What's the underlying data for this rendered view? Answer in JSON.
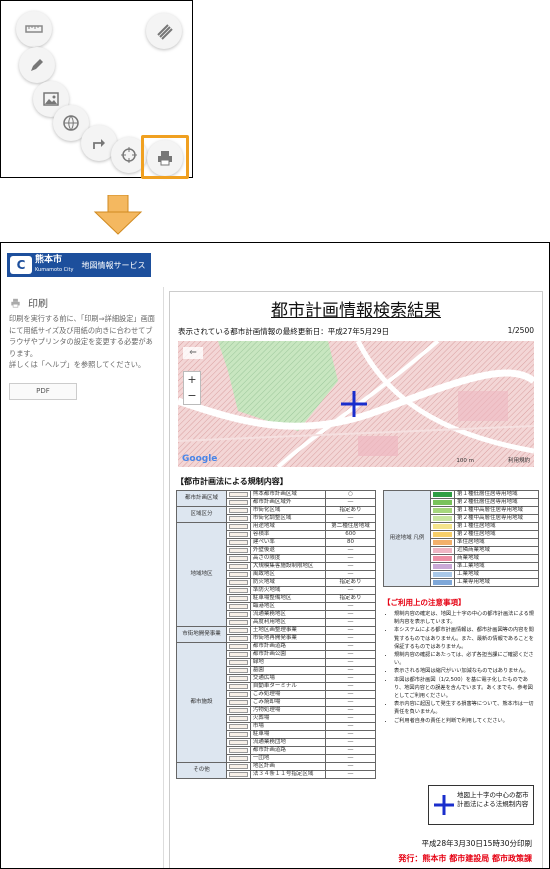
{
  "topbox": {
    "tools": [
      "ruler-icon",
      "menu-icon",
      "pen-icon",
      "image-icon",
      "globe-icon",
      "route-arrow-icon",
      "crosshair-icon",
      "print-icon"
    ]
  },
  "header": {
    "logo_city": "熊本市",
    "logo_sub": "Kumamoto City",
    "logo_service": "地図情報サービス"
  },
  "sidebar": {
    "title": "印刷",
    "desc": "印刷を実行する前に、「印刷⇒詳細設定」画面にて用紙サイズ及び用紙の向きに合わせてブラウザやプリンタの設定を変更する必要があります。\n詳しくは「ヘルプ」を参照してください。",
    "pdf_button": "PDF"
  },
  "paper": {
    "title": "都市計画情報検索結果",
    "updated": "表示されている都市計画情報の最終更新日：平成27年5月29日",
    "scale": "1/2500",
    "map_scale": "100 m",
    "map_terms": "利用規約",
    "map_brand": "Google",
    "section_title": "【都市計画法による規制内容】",
    "notice_title": "【ご利用上の注意事項】",
    "notice_items": [
      "規制内容の確定は、地図上十字の中心の都市計画法による規制内容を表示しています。",
      "本システムによる都市計画情報は、都市計画図等の内容を閲覧するものではありません。また、最新の情報であることを保証するものではありません。",
      "規制内容の確認にあたっては、必ず各担当課にご確認ください。",
      "表示される地図は縮尺がいい加減なものではありません。",
      "本図は都市計画図（1/2,500）を基に電子化したものであり、地図内容との誤差を含んでいます。あくまでも、参考図としてご利用ください。",
      "表示内容に起因して発生する損害等について、熊本市は一切責任を負いません。",
      "ご利用者自身の責任と判断で利用してください。"
    ],
    "legend_caption": "地図上十字の中心の都市計画法による法規制内容",
    "print_date": "平成28年3月30日15時30分印刷",
    "publisher": "発行：熊本市 都市建設局 都市政策課",
    "left_table": [
      {
        "cat": "都市計画区域",
        "rows": [
          [
            "熊本都市計画区域",
            "○"
          ],
          [
            "都市計画区域外",
            "―"
          ]
        ]
      },
      {
        "cat": "区域区分",
        "rows": [
          [
            "市街化区域",
            "指定あり"
          ],
          [
            "市街化調整区域",
            "―"
          ]
        ]
      },
      {
        "cat": "地域地区",
        "rows": [
          [
            "用途地域",
            "第二種住居地域"
          ],
          [
            "容積率",
            "600"
          ],
          [
            "建ぺい率",
            "80"
          ],
          [
            "外壁後退",
            "―"
          ],
          [
            "高さの限度",
            "―"
          ],
          [
            "大規模集客施設制限地区",
            "―"
          ],
          [
            "風致地区",
            "―"
          ],
          [
            "防火地域",
            "指定あり"
          ],
          [
            "準防火地域",
            "―"
          ],
          [
            "駐車場整備地区",
            "指定あり"
          ],
          [
            "臨港地区",
            "―"
          ],
          [
            "流通業務地区",
            "―"
          ],
          [
            "高度利用地区",
            "―"
          ]
        ]
      },
      {
        "cat": "市街地開発事業",
        "rows": [
          [
            "土地区画整理事業",
            "―"
          ],
          [
            "市街地再開発事業",
            "―"
          ]
        ]
      },
      {
        "cat": "都市施設",
        "rows": [
          [
            "都市計画道路",
            "―"
          ],
          [
            "都市計画公園",
            "―"
          ],
          [
            "緑地",
            "―"
          ],
          [
            "墓園",
            "―"
          ],
          [
            "交通広場",
            "―"
          ],
          [
            "自動車ターミナル",
            "―"
          ],
          [
            "ごみ処理場",
            "―"
          ],
          [
            "ごみ焼却場",
            "―"
          ],
          [
            "汚物処理場",
            "―"
          ],
          [
            "火葬場",
            "―"
          ],
          [
            "市場",
            "―"
          ],
          [
            "駐車場",
            "―"
          ],
          [
            "流通業務団地",
            "―"
          ],
          [
            "都市計画道路",
            "―"
          ],
          [
            "一団地",
            "―"
          ]
        ]
      },
      {
        "cat": "その他",
        "rows": [
          [
            "地区計画",
            "―"
          ],
          [
            "法３４条１１号指定区域",
            "―"
          ]
        ]
      }
    ],
    "right_table": [
      {
        "name": "第１種低層住居専用地域",
        "color": "#2f9e44"
      },
      {
        "name": "第２種低層住居専用地域",
        "color": "#79c35b"
      },
      {
        "name": "第１種中高層住居専用地域",
        "color": "#a6d77d"
      },
      {
        "name": "第２種中高層住居専用地域",
        "color": "#c8e6a0"
      },
      {
        "name": "第１種住居地域",
        "color": "#f4e48a"
      },
      {
        "name": "第２種住居地域",
        "color": "#f7cf6a"
      },
      {
        "name": "準住居地域",
        "color": "#f3b06a"
      },
      {
        "name": "近隣商業地域",
        "color": "#f0b6c4"
      },
      {
        "name": "商業地域",
        "color": "#ee8fa5"
      },
      {
        "name": "準工業地域",
        "color": "#c9a8d6"
      },
      {
        "name": "工業地域",
        "color": "#a9c8e8"
      },
      {
        "name": "工業専用地域",
        "color": "#7fa8d9"
      }
    ],
    "right_cat": "用途地域 凡例"
  },
  "colors": {
    "accent": "#f0a020",
    "brand": "#1d4f9c",
    "red": "#e60012"
  }
}
